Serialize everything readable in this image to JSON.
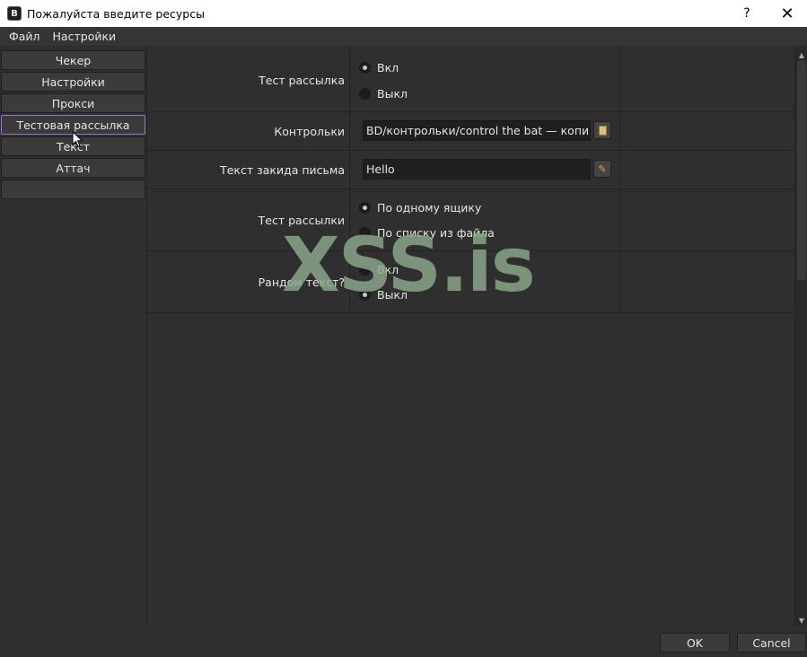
{
  "window": {
    "icon_letter": "B",
    "title": "Пожалуйста введите ресурсы",
    "help": "?",
    "close": "✕"
  },
  "menu": [
    "Файл",
    "Настройки"
  ],
  "nav": {
    "items": [
      {
        "label": "Чекер",
        "active": false
      },
      {
        "label": "Настройки",
        "active": false
      },
      {
        "label": "Прокси",
        "active": false
      },
      {
        "label": "Тестовая рассылка",
        "active": true
      },
      {
        "label": "Текст",
        "active": false
      },
      {
        "label": "Аттач",
        "active": false
      },
      {
        "label": "",
        "active": false
      }
    ]
  },
  "form": {
    "row1": {
      "label": "Тест рассылка",
      "options": [
        "Вкл",
        "Выкл"
      ],
      "selected": 0
    },
    "row2": {
      "label": "Контрольки",
      "value": "BD/контрольки/control the bat — копия.txt"
    },
    "row3": {
      "label": "Текст закида письма",
      "value": "Hello"
    },
    "row4": {
      "label": "Тест рассылки",
      "options": [
        "По одному ящику",
        "По списку из файла"
      ],
      "selected": 0
    },
    "row5": {
      "label": "Рандом текст?",
      "options": [
        "Вкл",
        "Выкл"
      ],
      "selected": 1
    }
  },
  "buttons": {
    "ok": "OK",
    "cancel": "Cancel"
  },
  "watermark": "XSS.is",
  "colors": {
    "active_border": "#a26fd0",
    "watermark": "#8caa8c"
  }
}
